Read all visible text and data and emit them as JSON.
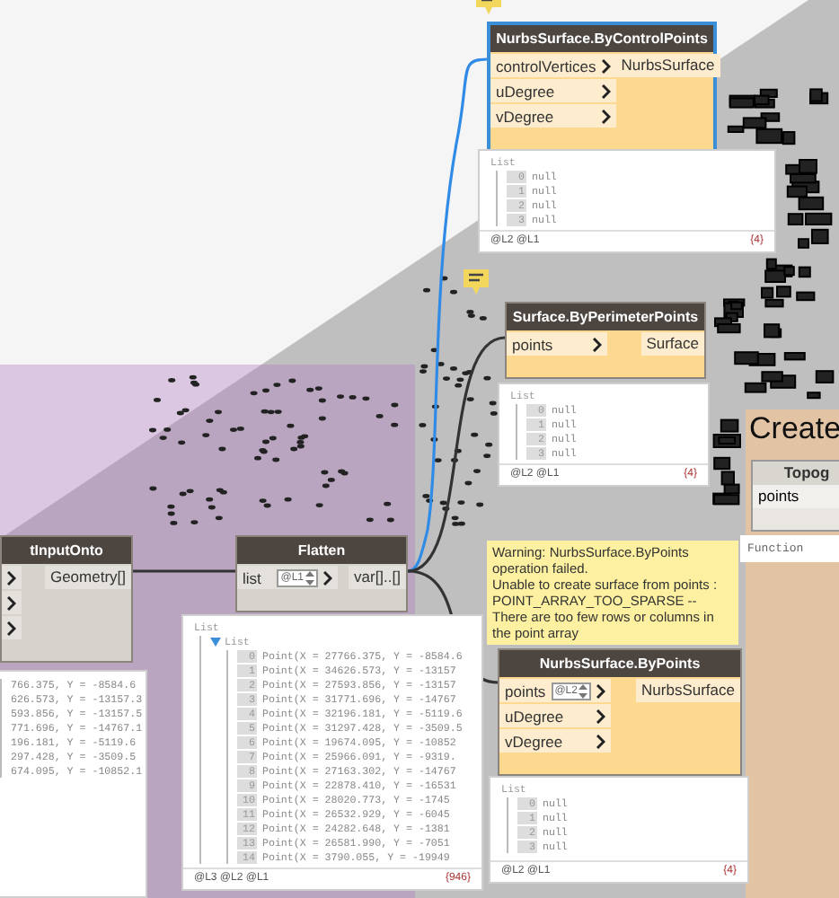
{
  "nodes": [
    {
      "title": "NurbsSurface.ByControlPoints",
      "selected": true,
      "warning": true,
      "inputs": [
        {
          "kind": "named",
          "name": "controlVertices"
        },
        {
          "kind": "named",
          "name": "uDegree"
        },
        {
          "kind": "named",
          "name": "vDegree"
        }
      ],
      "outputs": [
        "NurbsSurface"
      ],
      "preview": {
        "label": "List",
        "items": [
          {
            "index": "0",
            "value": "null"
          },
          {
            "index": "1",
            "value": "null"
          },
          {
            "index": "2",
            "value": "null"
          },
          {
            "index": "3",
            "value": "null"
          }
        ],
        "levels": "@L2 @L1",
        "count": "{4}"
      }
    },
    {
      "title": "Surface.ByPerimeterPoints",
      "selected": false,
      "warning": true,
      "inputs": [
        {
          "kind": "named",
          "name": "points"
        }
      ],
      "outputs": [
        "Surface"
      ],
      "preview": {
        "label": "List",
        "items": [
          {
            "index": "0",
            "value": "null"
          },
          {
            "index": "1",
            "value": "null"
          },
          {
            "index": "2",
            "value": "null"
          },
          {
            "index": "3",
            "value": "null"
          }
        ],
        "levels": "@L2 @L1",
        "count": "{4}"
      }
    },
    {
      "title": "tInputOnto",
      "selected": false,
      "warning": false,
      "inputs": [
        {
          "kind": "bare"
        },
        {
          "kind": "bare"
        },
        {
          "kind": "bare"
        }
      ],
      "outputs": [
        "Geometry[]"
      ],
      "preview": {
        "items": [
          {
            "value": "766.375, Y = -8584.6"
          },
          {
            "value": "626.573, Y = -13157.3"
          },
          {
            "value": "593.856, Y = -13157.5"
          },
          {
            "value": "771.696, Y = -14767.1"
          },
          {
            "value": "196.181, Y = -5119.6"
          },
          {
            "value": "297.428, Y = -3509.5"
          },
          {
            "value": "674.095, Y = -10852.1"
          }
        ]
      }
    },
    {
      "title": "Flatten",
      "selected": false,
      "warning": false,
      "inputs": [
        {
          "kind": "named",
          "name": "list",
          "lacing": "@L1"
        }
      ],
      "outputs": [
        "var[]..[]"
      ],
      "preview": {
        "label": "List",
        "sublists": [
          {
            "label": "List",
            "items": [
              {
                "index": "0",
                "value": "Point(X = 27766.375, Y = -8584.6"
              },
              {
                "index": "1",
                "value": "Point(X = 34626.573, Y = -13157"
              },
              {
                "index": "2",
                "value": "Point(X = 27593.856, Y = -13157"
              },
              {
                "index": "3",
                "value": "Point(X = 31771.696, Y = -14767"
              },
              {
                "index": "4",
                "value": "Point(X = 32196.181, Y = -5119.6"
              },
              {
                "index": "5",
                "value": "Point(X = 31297.428, Y = -3509.5"
              },
              {
                "index": "6",
                "value": "Point(X = 19674.095, Y = -10852"
              },
              {
                "index": "7",
                "value": "Point(X = 25966.091, Y = -9319."
              },
              {
                "index": "8",
                "value": "Point(X = 27163.302, Y = -14767"
              },
              {
                "index": "9",
                "value": "Point(X = 22878.410, Y = -16531"
              },
              {
                "index": "10",
                "value": "Point(X = 28020.773, Y = -1745"
              },
              {
                "index": "11",
                "value": "Point(X = 26532.929, Y = -6045"
              },
              {
                "index": "12",
                "value": "Point(X = 24282.648, Y = -1381"
              },
              {
                "index": "13",
                "value": "Point(X = 26581.990, Y = -7051"
              },
              {
                "index": "14",
                "value": "Point(X = 3790.055, Y = -19949"
              }
            ]
          }
        ],
        "levels": "@L3 @L2 @L1",
        "count": "{946}"
      }
    },
    {
      "title": "NurbsSurface.ByPoints",
      "selected": false,
      "warning": true,
      "inputs": [
        {
          "kind": "named",
          "name": "points",
          "lacing": "@L2"
        },
        {
          "kind": "named",
          "name": "uDegree"
        },
        {
          "kind": "named",
          "name": "vDegree"
        }
      ],
      "outputs": [
        "NurbsSurface"
      ],
      "preview": {
        "label": "List",
        "items": [
          {
            "index": "0",
            "value": "null"
          },
          {
            "index": "1",
            "value": "null"
          },
          {
            "index": "2",
            "value": "null"
          },
          {
            "index": "3",
            "value": "null"
          }
        ],
        "levels": "@L2 @L1",
        "count": "{4}"
      }
    }
  ],
  "warning": {
    "lines": [
      "Warning: NurbsSurface.ByPoints operation failed.",
      "Unable to create surface from points : POINT_ARRAY_TOO_SPARSE -- There are too few rows or columns in the point array"
    ]
  },
  "group": {
    "title": "Create",
    "node_title": "Topog",
    "input": "points",
    "function_preview": "Function"
  }
}
